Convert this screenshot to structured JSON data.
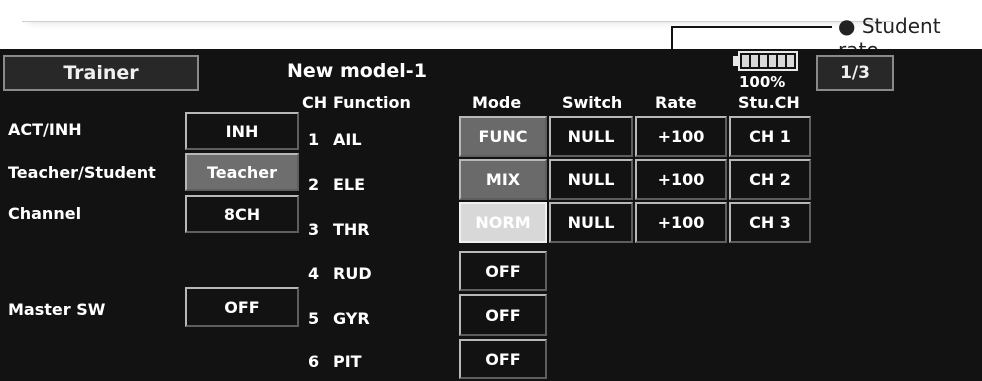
{
  "callout": {
    "label": "Student rate"
  },
  "header": {
    "title": "Trainer",
    "model": "New model-1",
    "battery_percent": "100%",
    "page": "1/3"
  },
  "columns": {
    "ch": "CH",
    "function": "Function",
    "mode": "Mode",
    "switch": "Switch",
    "rate": "Rate",
    "stu_ch": "Stu.CH"
  },
  "settings": {
    "act_inh": {
      "label": "ACT/INH",
      "value": "INH"
    },
    "teacher_student": {
      "label": "Teacher/Student",
      "value": "Teacher"
    },
    "channel": {
      "label": "Channel",
      "value": "8CH"
    },
    "master_sw": {
      "label": "Master SW",
      "value": "OFF"
    }
  },
  "rows": [
    {
      "ch": "1",
      "function": "AIL",
      "mode": "FUNC",
      "switch": "NULL",
      "rate": "+100",
      "stu_ch": "CH 1"
    },
    {
      "ch": "2",
      "function": "ELE",
      "mode": "MIX",
      "switch": "NULL",
      "rate": "+100",
      "stu_ch": "CH 2"
    },
    {
      "ch": "3",
      "function": "THR",
      "mode": "NORM",
      "switch": "NULL",
      "rate": "+100",
      "stu_ch": "CH 3"
    },
    {
      "ch": "4",
      "function": "RUD",
      "mode": "OFF"
    },
    {
      "ch": "5",
      "function": "GYR",
      "mode": "OFF"
    },
    {
      "ch": "6",
      "function": "PIT",
      "mode": "OFF"
    }
  ],
  "colors": {
    "screen_bg": "#121212",
    "highlight_button": "#d8d8d8",
    "selected_button": "#6e6e6e"
  }
}
